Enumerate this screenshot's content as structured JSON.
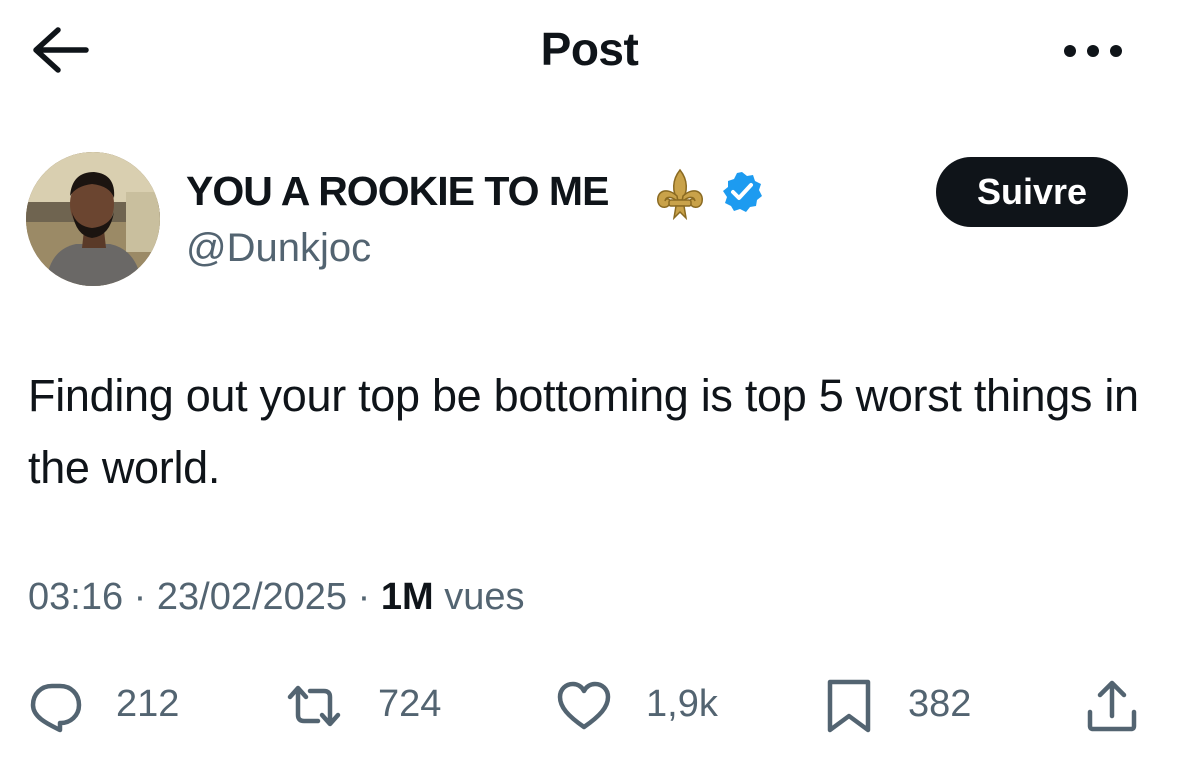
{
  "header": {
    "title": "Post"
  },
  "author": {
    "display_name": "YOU A ROOKIE TO ME",
    "handle": "@Dunkjoc",
    "follow_label": "Suivre"
  },
  "post": {
    "text": "Finding out your top be bottoming is top 5 worst things in the world.",
    "time": "03:16",
    "date": "23/02/2025",
    "separator": "·",
    "views_count": "1M",
    "views_label": "vues"
  },
  "actions": {
    "replies": "212",
    "reposts": "724",
    "likes": "1,9k",
    "bookmarks": "382"
  },
  "colors": {
    "text_primary": "#0f1419",
    "text_secondary": "#536471",
    "verified_blue": "#1d9bf0",
    "follow_button_bg": "#0f1419"
  },
  "icons": [
    "back-arrow-icon",
    "more-options-icon",
    "fleur-de-lis-icon",
    "verified-badge-icon",
    "reply-icon",
    "repost-icon",
    "like-icon",
    "bookmark-icon",
    "share-icon"
  ]
}
